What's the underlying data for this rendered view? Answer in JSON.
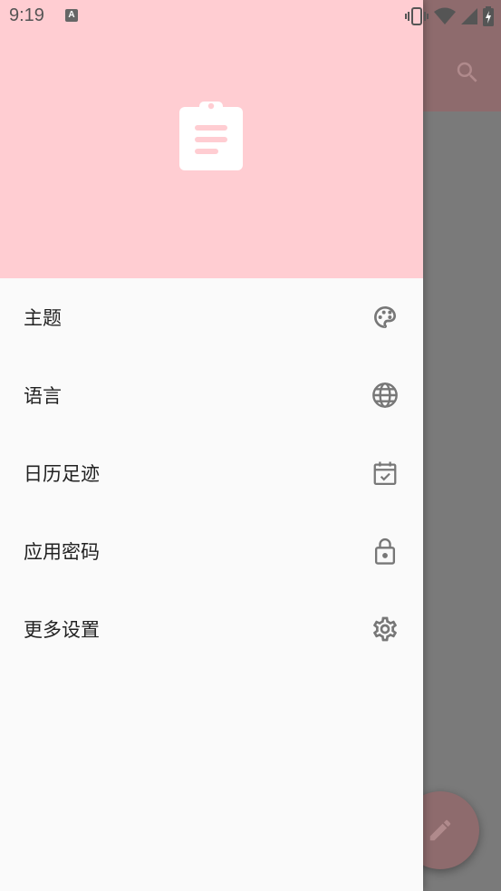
{
  "status_bar": {
    "time": "9:19",
    "notification_glyph": "A"
  },
  "drawer": {
    "header_icon": "clipboard-icon",
    "header_color": "#ffcdd2",
    "items": [
      {
        "label": "主题",
        "icon": "palette-icon"
      },
      {
        "label": "语言",
        "icon": "globe-icon"
      },
      {
        "label": "日历足迹",
        "icon": "calendar-check-icon"
      },
      {
        "label": "应用密码",
        "icon": "lock-icon"
      },
      {
        "label": "更多设置",
        "icon": "gear-icon"
      }
    ]
  },
  "background_app": {
    "search_icon": "search-icon",
    "fab_icon": "pencil-icon",
    "appbar_color": "#8e6b6d"
  }
}
